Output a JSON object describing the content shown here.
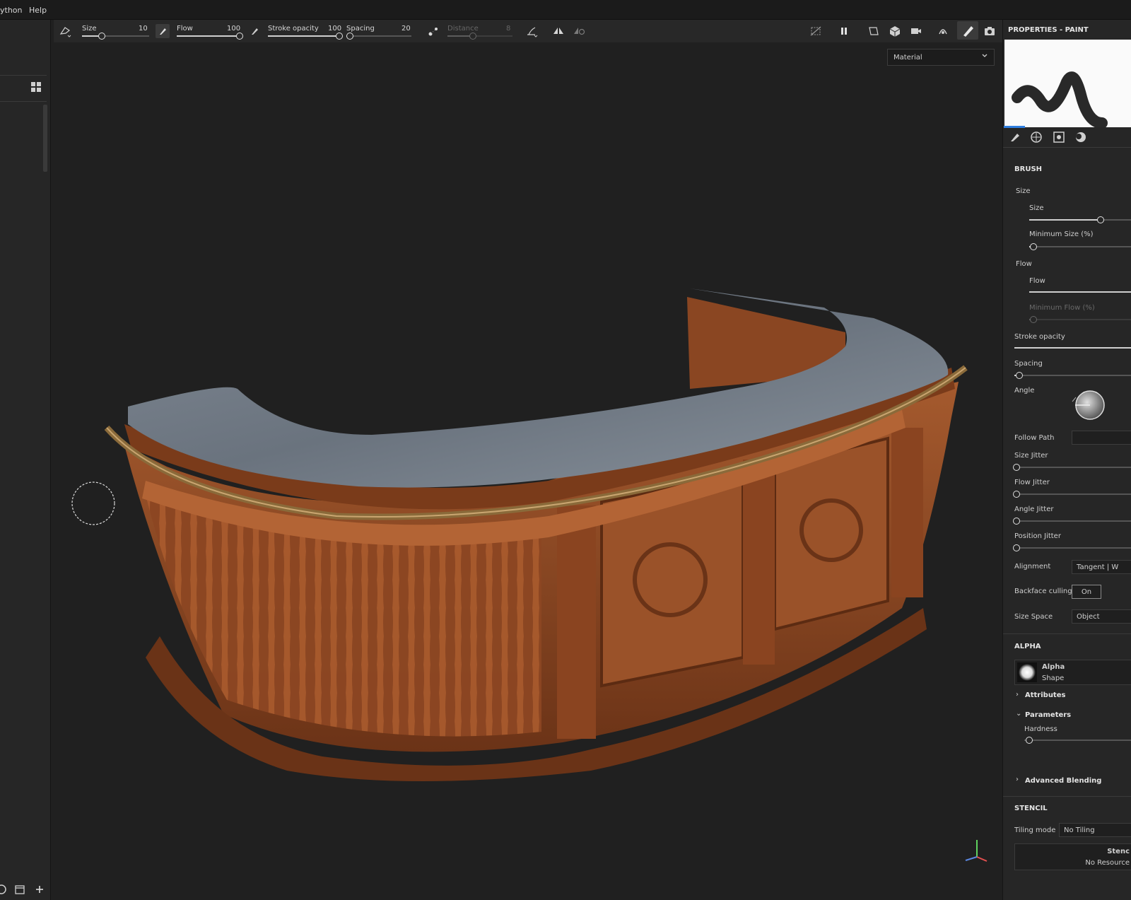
{
  "menubar": {
    "items": [
      {
        "label": "ython"
      },
      {
        "label": "Help"
      }
    ]
  },
  "toolbar": {
    "size": {
      "label": "Size",
      "value": "10",
      "level": 0.3
    },
    "flow": {
      "label": "Flow",
      "value": "100",
      "level": 1.0
    },
    "stroke_opacity": {
      "label": "Stroke opacity",
      "value": "100",
      "level": 1.0
    },
    "spacing": {
      "label": "Spacing",
      "value": "20",
      "level": 0.05
    },
    "distance": {
      "label": "Distance",
      "value": "8",
      "level": 0.4
    }
  },
  "viewport": {
    "display_mode": "Material"
  },
  "properties": {
    "title": "PROPERTIES - PAINT",
    "brush": {
      "header": "BRUSH",
      "size_group": "Size",
      "size_label": "Size",
      "size_level": 0.7,
      "min_size_label": "Minimum Size (%)",
      "min_size_level": 0.05,
      "flow_group": "Flow",
      "flow_label": "Flow",
      "flow_level": 1.0,
      "min_flow_label": "Minimum Flow (%)",
      "min_flow_level": 0.05,
      "stroke_opacity_label": "Stroke opacity",
      "stroke_opacity_level": 1.0,
      "spacing_label": "Spacing",
      "spacing_level": 0.05,
      "angle_label": "Angle",
      "follow_path_label": "Follow Path",
      "size_jitter_label": "Size Jitter",
      "flow_jitter_label": "Flow Jitter",
      "angle_jitter_label": "Angle Jitter",
      "position_jitter_label": "Position Jitter",
      "alignment_label": "Alignment",
      "alignment_value": "Tangent | W",
      "backface_label": "Backface culling",
      "backface_value": "On",
      "size_space_label": "Size Space",
      "size_space_value": "Object"
    },
    "alpha": {
      "header": "ALPHA",
      "name": "Alpha",
      "sub": "Shape",
      "attributes": "Attributes",
      "parameters": "Parameters",
      "hardness": "Hardness",
      "advanced": "Advanced Blending"
    },
    "stencil": {
      "header": "STENCIL",
      "tiling_label": "Tiling mode",
      "tiling_value": "No Tiling",
      "stencil_name": "Stenc",
      "stencil_resource": "No Resource"
    }
  },
  "colors": {
    "accent": "#2f7ee0",
    "panel": "#262626",
    "viewport": "#202020"
  }
}
